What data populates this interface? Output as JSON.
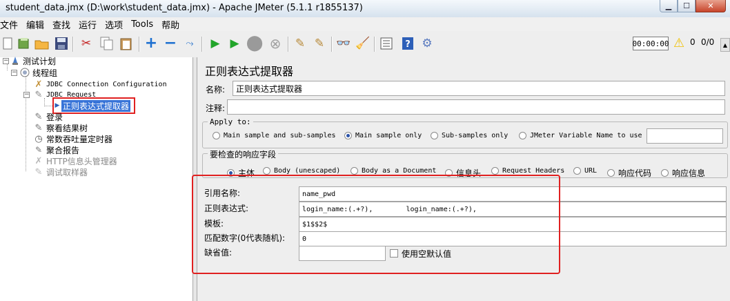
{
  "window": {
    "title": "student_data.jmx (D:\\work\\student_data.jmx) - Apache JMeter (5.1.1 r1855137)",
    "minimize": "▁",
    "maximize": "☐",
    "close": "✕"
  },
  "menu": [
    "文件",
    "编辑",
    "查找",
    "运行",
    "选项",
    "Tools",
    "帮助"
  ],
  "toolbar": {
    "icons": [
      "new-icon",
      "templates-icon",
      "open-icon",
      "save-icon",
      "cut-icon",
      "copy-icon",
      "paste-icon",
      "expand-icon",
      "collapse-icon",
      "toggle-icon",
      "start-icon",
      "start-no-pause-icon",
      "stop-icon",
      "shutdown-icon",
      "clear-icon",
      "clear-all-icon",
      "search-icon",
      "reset-search-icon",
      "function-helper-icon",
      "help-icon",
      "remote-icon"
    ],
    "timer": "00:00:00",
    "warning_count": "0",
    "ratio": "0/0"
  },
  "tree": {
    "test_plan": "测试计划",
    "thread_group": "线程组",
    "jdbc_config": "JDBC Connection Configuration",
    "jdbc_request": "JDBC Request",
    "regex_extractor": "正则表达式提取器",
    "login": "登录",
    "view_results": "察看结果树",
    "timer": "常数吞吐量定时器",
    "aggregate": "聚合报告",
    "header_manager": "HTTP信息头管理器",
    "debug_sampler": "调试取样器"
  },
  "panel": {
    "title": "正则表达式提取器",
    "name_label": "名称:",
    "name_value": "正则表达式提取器",
    "comment_label": "注释:",
    "comment_value": "",
    "apply_to": {
      "title": "Apply to:",
      "options": [
        "Main sample and sub-samples",
        "Main sample only",
        "Sub-samples only",
        "JMeter Variable Name to use"
      ],
      "selected": 1,
      "variable_value": ""
    },
    "field_to_check": {
      "title": "要检查的响应字段",
      "options": [
        "主体",
        "Body (unescaped)",
        "Body as a Document",
        "信息头",
        "Request Headers",
        "URL",
        "响应代码",
        "响应信息"
      ],
      "selected": 0
    },
    "ref_name_label": "引用名称:",
    "ref_name_value": "name_pwd",
    "regex_label": "正则表达式:",
    "regex_value": "login_name:(.+?),        login_name:(.+?),",
    "template_label": "模板:",
    "template_value": "$1$$2$",
    "match_no_label": "匹配数字(0代表随机):",
    "match_no_value": "0",
    "default_label": "缺省值:",
    "default_value": "",
    "use_empty_default_label": "使用空默认值",
    "use_empty_default_checked": false
  }
}
